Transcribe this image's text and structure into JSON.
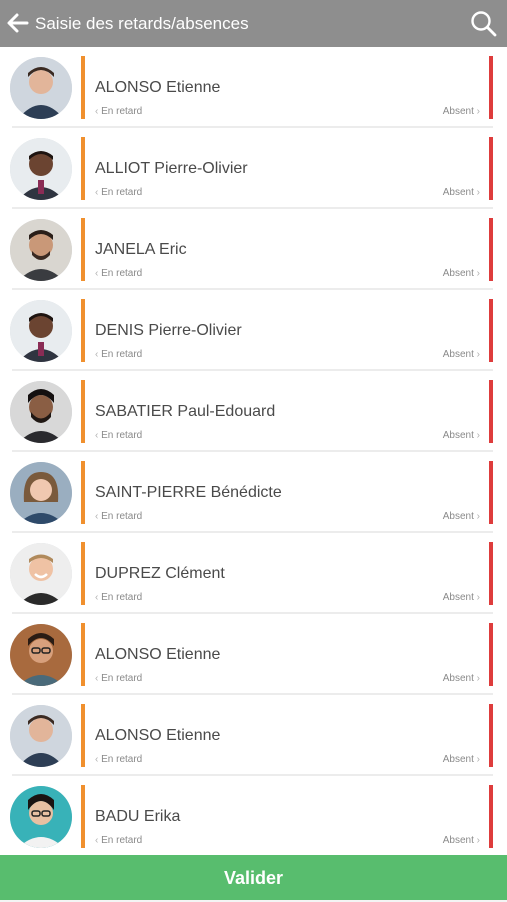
{
  "header": {
    "title": "Saisie des retards/absences",
    "back_icon": "arrow-left-icon",
    "search_icon": "search-icon"
  },
  "colors": {
    "header_bg": "#8e8e8e",
    "late_accent": "#f0902e",
    "absent_accent": "#de3c3c",
    "validate_bg": "#58bd6e"
  },
  "students": [
    {
      "name": "ALONSO Etienne",
      "late_label": "En retard",
      "absent_label": "Absent"
    },
    {
      "name": "ALLIOT Pierre-Olivier",
      "late_label": "En retard",
      "absent_label": "Absent"
    },
    {
      "name": "JANELA Eric",
      "late_label": "En retard",
      "absent_label": "Absent"
    },
    {
      "name": "DENIS Pierre-Olivier",
      "late_label": "En retard",
      "absent_label": "Absent"
    },
    {
      "name": "SABATIER Paul-Edouard",
      "late_label": "En retard",
      "absent_label": "Absent"
    },
    {
      "name": "SAINT-PIERRE Bénédicte",
      "late_label": "En retard",
      "absent_label": "Absent"
    },
    {
      "name": "DUPREZ Clément",
      "late_label": "En retard",
      "absent_label": "Absent"
    },
    {
      "name": "ALONSO Etienne",
      "late_label": "En retard",
      "absent_label": "Absent"
    },
    {
      "name": "ALONSO Etienne",
      "late_label": "En retard",
      "absent_label": "Absent"
    },
    {
      "name": "BADU Erika",
      "late_label": "En retard",
      "absent_label": "Absent"
    }
  ],
  "footer": {
    "validate_label": "Valider"
  }
}
